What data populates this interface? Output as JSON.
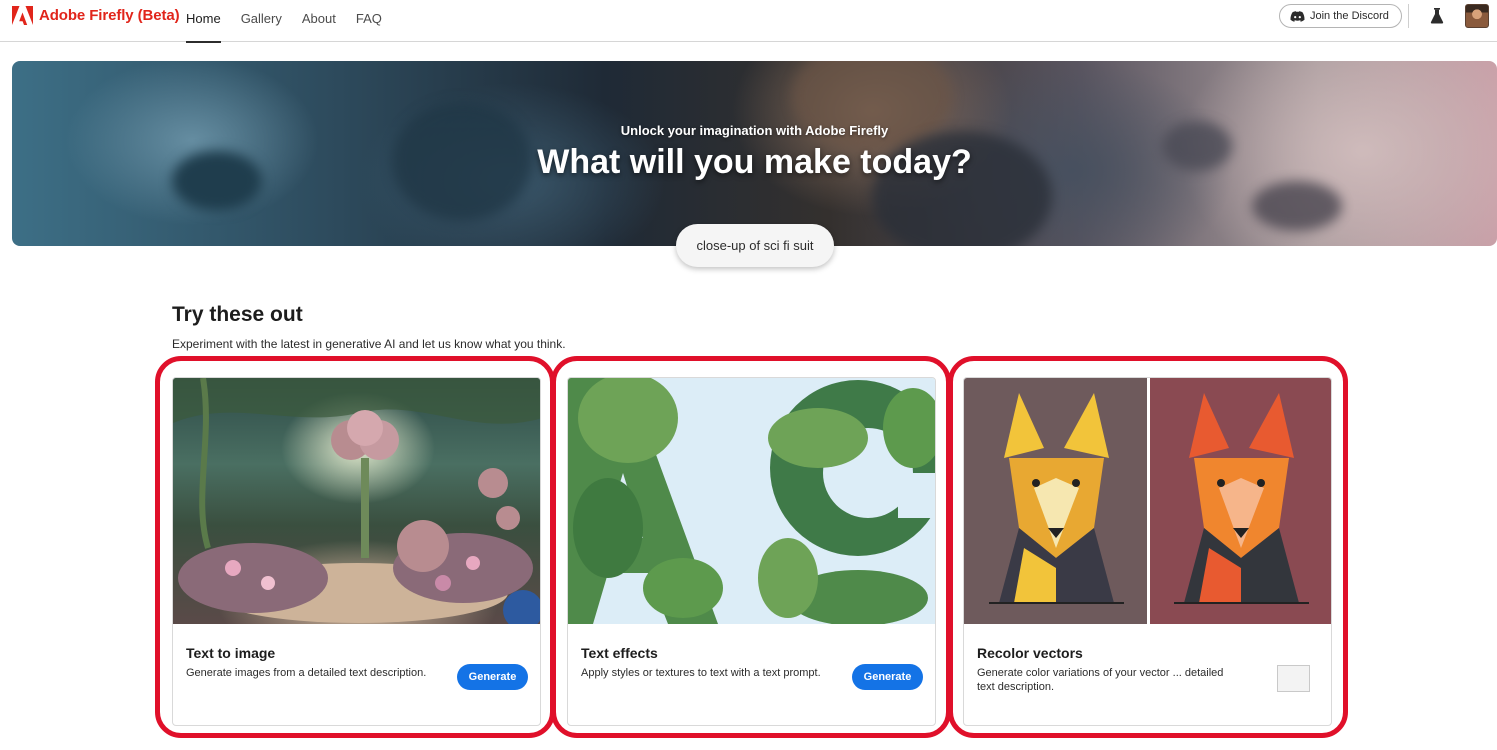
{
  "nav": {
    "brand": "Adobe Firefly (Beta)",
    "links": [
      {
        "label": "Home",
        "active": true
      },
      {
        "label": "Gallery",
        "active": false
      },
      {
        "label": "About",
        "active": false
      },
      {
        "label": "FAQ",
        "active": false
      }
    ],
    "discord_label": "Join the Discord",
    "icons": [
      "adobe-logo-icon",
      "discord-icon",
      "beaker-icon",
      "avatar"
    ]
  },
  "hero": {
    "subtitle": "Unlock your imagination with Adobe Firefly",
    "title": "What will you make today?",
    "prompt": "close-up of sci fi suit"
  },
  "section": {
    "title": "Try these out",
    "description": "Experiment with the latest in generative AI and let us know what you think."
  },
  "cards": [
    {
      "title": "Text to image",
      "description": "Generate images from a detailed text description.",
      "button": "Generate"
    },
    {
      "title": "Text effects",
      "description": "Apply styles or textures to text with a text prompt.",
      "button": "Generate"
    },
    {
      "title": "Recolor vectors",
      "description": "Generate color variations of your vector ... detailed text description.",
      "button": ""
    }
  ],
  "colors": {
    "brand_red": "#e1251b",
    "accent_blue": "#1473e6",
    "highlight_red": "#e0102a"
  }
}
